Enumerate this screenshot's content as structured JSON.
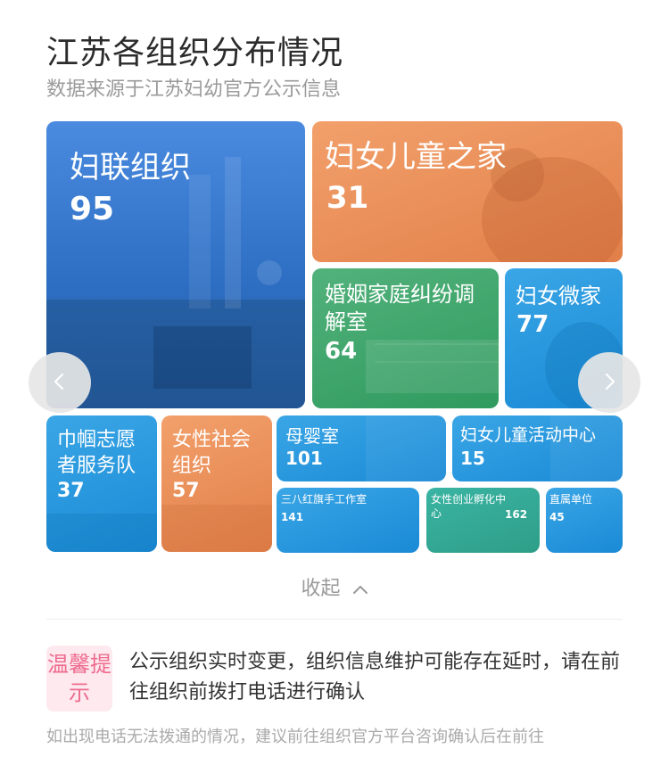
{
  "page": {
    "title": "江苏各组织分布情况",
    "subtitle": "数据来源于江苏妇幼官方公示信息"
  },
  "tiles": [
    {
      "label": "妇联组织",
      "count": "95"
    },
    {
      "label": "妇女儿童之家",
      "count": "31"
    },
    {
      "label": "婚姻家庭纠纷调解室",
      "count": "64"
    },
    {
      "label": "妇女微家",
      "count": "77"
    },
    {
      "label": "巾帼志愿者服务队",
      "count": "37"
    },
    {
      "label": "女性社会组织",
      "count": "57"
    },
    {
      "label": "母婴室",
      "count": "101"
    },
    {
      "label": "妇女儿童活动中心",
      "count": "15"
    },
    {
      "label": "三八红旗手工作室",
      "count": "141"
    },
    {
      "label": "女性创业孵化中心",
      "count": "162"
    },
    {
      "label": "直属单位",
      "count": "45"
    }
  ],
  "controls": {
    "collapse_label": "收起",
    "prev_icon": "chevron-left-icon",
    "next_icon": "chevron-right-icon"
  },
  "tip": {
    "badge": "温馨提示",
    "text": "公示组织实时变更，组织信息维护可能存在延时，请在前往组织前拨打电话进行确认",
    "footer": "如出现电话无法拨通的情况，建议前往组织官方平台咨询确认后在前往"
  },
  "colors": {
    "blue": "#1a8ad6",
    "orange": "#e27f49",
    "green": "#2f9a5e",
    "accent_pink": "#ef6b8e"
  }
}
